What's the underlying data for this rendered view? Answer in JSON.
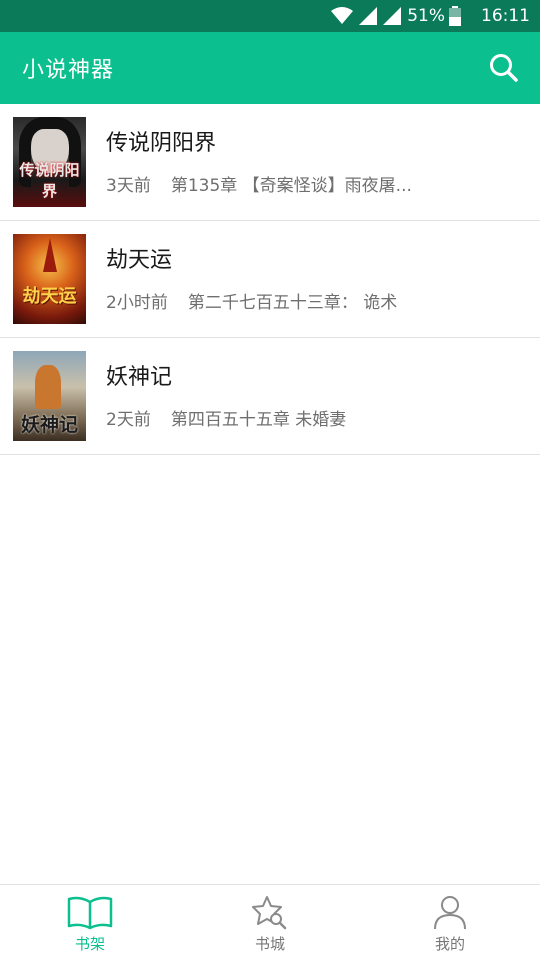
{
  "status_bar": {
    "battery_percent": "51%",
    "time": "16:11",
    "icons": [
      "wifi-icon",
      "signal-icon",
      "signal-icon",
      "battery-icon"
    ]
  },
  "app_bar": {
    "title": "小说神器",
    "search_icon": "search-icon"
  },
  "books": [
    {
      "title": "传说阴阳界",
      "time_ago": "3天前",
      "latest_chapter": "第135章 【奇案怪谈】雨夜屠...",
      "cover_text": "传说阴阳界"
    },
    {
      "title": "劫天运",
      "time_ago": "2小时前",
      "latest_chapter": "第二千七百五十三章： 诡术",
      "cover_text": "劫天运"
    },
    {
      "title": "妖神记",
      "time_ago": "2天前",
      "latest_chapter": "第四百五十五章 未婚妻",
      "cover_text": "妖神记"
    }
  ],
  "bottom_nav": {
    "items": [
      {
        "label": "书架",
        "icon": "open-book-icon",
        "active": true
      },
      {
        "label": "书城",
        "icon": "star-search-icon",
        "active": false
      },
      {
        "label": "我的",
        "icon": "person-icon",
        "active": false
      }
    ]
  },
  "colors": {
    "status_bar_bg": "#0a7a58",
    "accent": "#0bbf8f",
    "inactive_nav": "#777777"
  }
}
